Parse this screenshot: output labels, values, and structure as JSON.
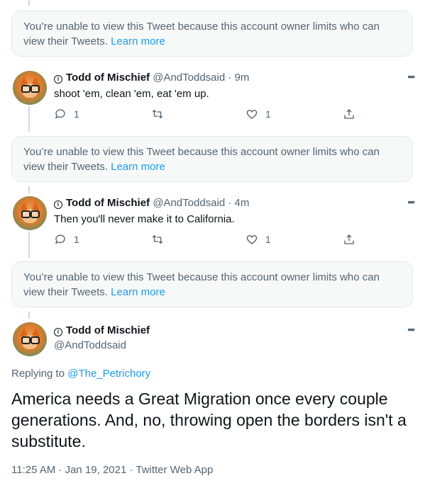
{
  "notice": {
    "text": "You’re unable to view this Tweet because this account owner limits who can view their Tweets.",
    "link": "Learn more"
  },
  "author": {
    "name": "Todd of Mischief",
    "handle": "@AndToddsaid",
    "lock_glyph": "i"
  },
  "tweets": [
    {
      "time": "9m",
      "text": "shoot 'em, clean 'em, eat 'em up.",
      "reply_count": "1",
      "like_count": "1"
    },
    {
      "time": "4m",
      "text": "Then you'll never make it to California.",
      "reply_count": "1",
      "like_count": "1"
    }
  ],
  "main_tweet": {
    "replying_label": "Replying to",
    "replying_to": "@The_Petrichory",
    "text": "America needs a Great Migration once every couple generations. And, no, throwing open the borders isn't a substitute.",
    "timestamp": "11:25 AM · Jan 19, 2021 · Twitter Web App"
  },
  "more_glyph": "•••",
  "dot_sep": "·",
  "colors": {
    "link": "#1d9bf0",
    "muted": "#536471",
    "text": "#0f1419"
  },
  "icons": [
    "reply-icon",
    "retweet-icon",
    "like-icon",
    "share-icon",
    "more-icon",
    "lock-icon"
  ]
}
